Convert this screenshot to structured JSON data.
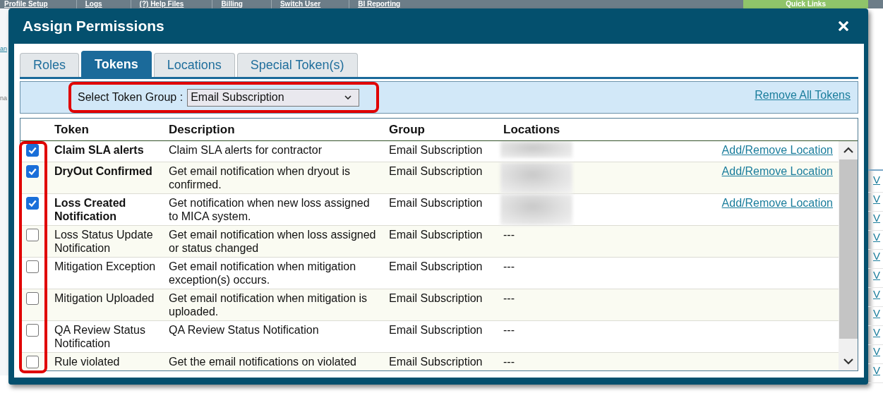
{
  "nav": [
    {
      "label": "Profile Setup"
    },
    {
      "label": "Logs"
    },
    {
      "label": "(?) Help Files"
    },
    {
      "label": "Billing"
    },
    {
      "label": "Switch User"
    },
    {
      "label": "BI Reporting"
    }
  ],
  "quick_links": "Quick Links",
  "left_fragments": [
    "an",
    "na"
  ],
  "right_links": [
    "V",
    "V",
    "V",
    "V",
    "V",
    "V",
    "V",
    "V",
    "V",
    "V",
    "V"
  ],
  "dialog": {
    "title": "Assign Permissions"
  },
  "tabs": [
    {
      "label": "Roles",
      "selected": false
    },
    {
      "label": "Tokens",
      "selected": true
    },
    {
      "label": "Locations",
      "selected": false
    },
    {
      "label": "Special Token(s)",
      "selected": false
    }
  ],
  "filter": {
    "label": "Select Token Group :",
    "value": "Email Subscription",
    "remove_link": "Remove All Tokens"
  },
  "table": {
    "columns": [
      "Token",
      "Description",
      "Group",
      "Locations"
    ],
    "rows": [
      {
        "checked": true,
        "token": "Claim SLA alerts",
        "description": "Claim SLA alerts for contractor",
        "group": "Email Subscription",
        "locations_blurred": true,
        "action": "Add/Remove Location"
      },
      {
        "checked": true,
        "token": "DryOut Confirmed",
        "description": "Get email notification when dryout is confirmed.",
        "group": "Email Subscription",
        "locations_blurred": true,
        "action": "Add/Remove Location"
      },
      {
        "checked": true,
        "token": "Loss Created Notification",
        "description": "Get notification when new loss assigned to MICA system.",
        "group": "Email Subscription",
        "locations_blurred": true,
        "action": "Add/Remove Location"
      },
      {
        "checked": false,
        "token": "Loss Status Update Notification",
        "description": "Get email notification when loss assigned or status changed",
        "group": "Email Subscription",
        "locations": "---"
      },
      {
        "checked": false,
        "token": "Mitigation Exception",
        "description": "Get email notification when mitigation exception(s) occurs.",
        "group": "Email Subscription",
        "locations": "---"
      },
      {
        "checked": false,
        "token": "Mitigation Uploaded",
        "description": "Get email notification when mitigation is uploaded.",
        "group": "Email Subscription",
        "locations": "---"
      },
      {
        "checked": false,
        "token": "QA Review Status Notification",
        "description": "QA Review Status Notification",
        "group": "Email Subscription",
        "locations": "---"
      },
      {
        "checked": false,
        "token": "Rule violated",
        "description": "Get the email notifications on violated",
        "group": "Email Subscription",
        "locations": "---"
      }
    ]
  }
}
